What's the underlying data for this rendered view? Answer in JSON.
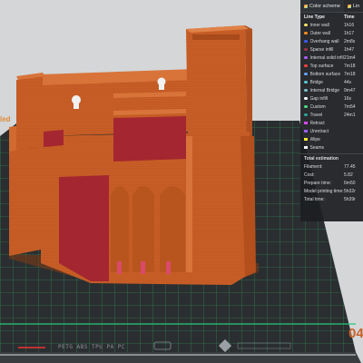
{
  "app": {
    "bed_label": "PETG ABS TPU PA PC",
    "plate_number": "04",
    "edge_label": "led"
  },
  "panel": {
    "tabs": [
      {
        "label": "Color scheme"
      },
      {
        "label": "Lin"
      }
    ],
    "columns": {
      "type": "Line Type",
      "time": "Time"
    },
    "line_types": [
      {
        "name": "Inner wall",
        "time": "1h16",
        "color": "#ffe066"
      },
      {
        "name": "Outer wall",
        "time": "1h17",
        "color": "#ff8c1a"
      },
      {
        "name": "Overhang wall",
        "time": "2m8s",
        "color": "#3d5cff"
      },
      {
        "name": "Sparse infill",
        "time": "1h47",
        "color": "#a0304a"
      },
      {
        "name": "Internal solid infill",
        "time": "21m4",
        "color": "#b05cff"
      },
      {
        "name": "Top surface",
        "time": "7m18",
        "color": "#ff4040"
      },
      {
        "name": "Bottom surface",
        "time": "7m18",
        "color": "#66a3ff"
      },
      {
        "name": "Bridge",
        "time": "44s",
        "color": "#5cc8d8"
      },
      {
        "name": "Internal Bridge",
        "time": "9m47",
        "color": "#7ac0c8"
      },
      {
        "name": "Gap infill",
        "time": "16s",
        "color": "#ffffff"
      },
      {
        "name": "Custom",
        "time": "7m54",
        "color": "#4ade80"
      },
      {
        "name": "Travel",
        "time": "24m1",
        "color": "#26a69a"
      }
    ],
    "toggles": [
      {
        "name": "Retract",
        "color": "#d946ef"
      },
      {
        "name": "Unretract",
        "color": "#9b5cff"
      },
      {
        "name": "Wipe",
        "color": "#ffee33"
      },
      {
        "name": "Seams",
        "color": "#f2f2f2"
      }
    ],
    "estimation_title": "Total estimation",
    "estimation": [
      {
        "label": "Filament:",
        "value": "77.45"
      },
      {
        "label": "Cost:",
        "value": "5.82"
      },
      {
        "label": "Prepare time:",
        "value": "6m50"
      },
      {
        "label": "Model printing time:",
        "value": "5h32r"
      },
      {
        "label": "Total time:",
        "value": "5h39r"
      }
    ]
  },
  "colors": {
    "model": "#c95f27",
    "infill": "#a42630",
    "bed": "#2b2e30",
    "grid": "#27c77a",
    "panel_bg": "#1c1e21"
  }
}
